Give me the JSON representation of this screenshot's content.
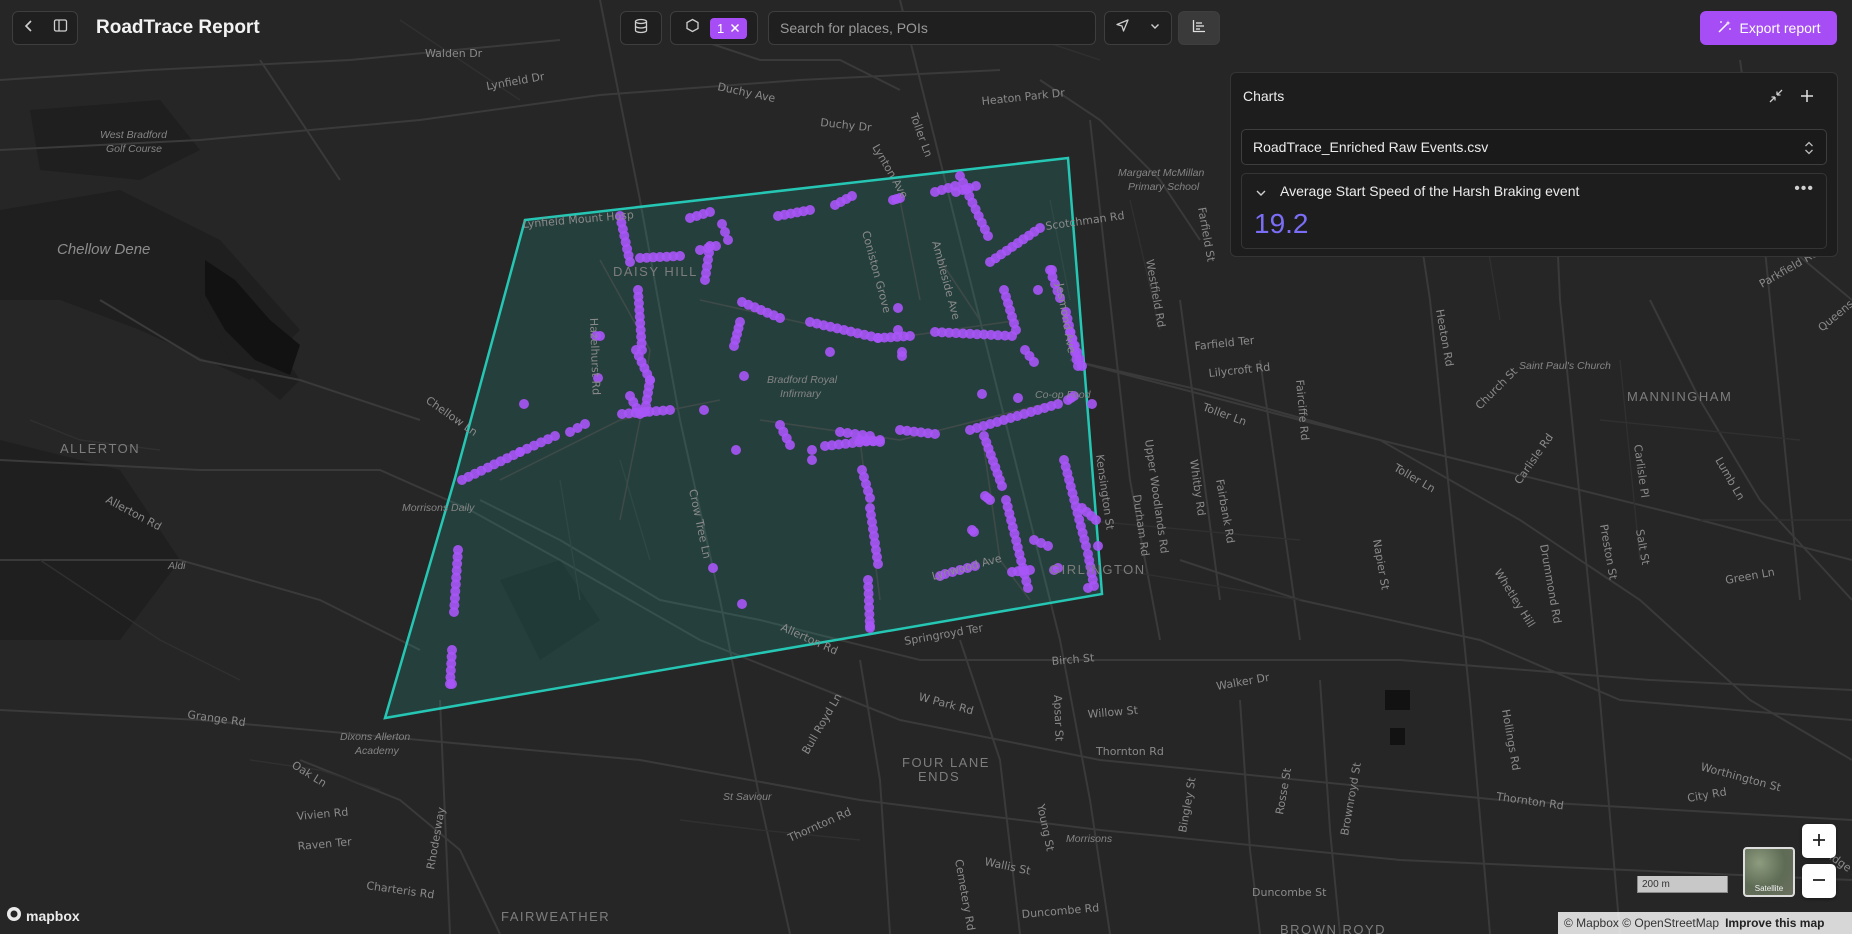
{
  "header": {
    "title": "RoadTrace Report",
    "filter_count": "1",
    "search_placeholder": "Search for places, POIs",
    "export_label": "Export report"
  },
  "charts_panel": {
    "title": "Charts",
    "dataset": "RoadTrace_Enriched Raw Events.csv",
    "metric": {
      "title": "Average Start Speed of the Harsh Braking event",
      "value": "19.2"
    }
  },
  "map": {
    "scale_label": "200 m",
    "satellite_label": "Satellite",
    "attribution": "© Mapbox © OpenStreetMap",
    "improve_label": "Improve this map",
    "logo_text": "mapbox",
    "colors": {
      "polygon": "#25c7b4",
      "events": "#a855f7",
      "accent": "#a64df5",
      "metric": "#7b6ef6"
    },
    "labels": {
      "walden": "Walden Dr",
      "lynfield": "Lynfield Dr",
      "duchy_ave": "Duchy Ave",
      "duchy_dr": "Duchy Dr",
      "toller_ln_n": "Toller Ln",
      "heaton_park": "Heaton Park Dr",
      "lynton": "Lynton Ave",
      "west_bradford": "West Bradford",
      "golf_course": "Golf Course",
      "chellow_dene": "Chellow Dene",
      "margaret1": "Margaret McMillan",
      "margaret2": "Primary School",
      "lynfield_hosp": "Lynfield Mount Hosp",
      "daisy_hill": "DAISY HILL",
      "scotchman": "Scotchman Rd",
      "coniston": "Coniston Grove",
      "ambleside": "Ambleside Ave",
      "jesmond": "Jesmond Ave",
      "hazelhurst": "Hazelhurst Rd",
      "infirmary1": "Bradford Royal",
      "infirmary2": "Infirmary",
      "farfield_st": "Farfield St",
      "westfield": "Westfield Rd",
      "farfield_ter": "Farfield Ter",
      "lilycroft": "Lilycroft Rd",
      "toller_ln_e": "Toller Ln",
      "coop": "Co-op Food",
      "allerton": "ALLERTON",
      "chellow_ln": "Chellow Ln",
      "allerton_rd": "Allerton Rd",
      "aldi": "Aldi",
      "morrisons_daily": "Morrisons Daily",
      "crow_tree": "Crow Tree Ln",
      "lynwood": "Lynwood Ave",
      "girlington": "GIRLINGTON",
      "kensington": "Kensington St",
      "upper_woodlands": "Upper Woodlands Rd",
      "durham": "Durham Rd",
      "whitby": "Whitby Rd",
      "fairbank": "Fairbank Rd",
      "allerton_rd2": "Allerton Rd",
      "springroyd": "Springroyd Ter",
      "birch": "Birch St",
      "walker": "Walker Dr",
      "w_park": "W Park Rd",
      "willow": "Willow St",
      "thornton_1": "Thornton Rd",
      "thornton_2": "Thornton Rd",
      "thornton_3": "Thornton Rd",
      "four_lane_1": "FOUR LANE",
      "four_lane_2": "ENDS",
      "st_saviour": "St Saviour",
      "grange": "Grange Rd",
      "dixons1": "Dixons Allerton",
      "dixons2": "Academy",
      "oak_ln": "Oak Ln",
      "vivien": "Vivien Rd",
      "raven": "Raven Ter",
      "charteris": "Charteris Rd",
      "rhodesway": "Rhodesway",
      "fairweather": "FAIRWEATHER",
      "bull_royd": "Bull Royd Ln",
      "cemetery": "Cemetery Rd",
      "young": "Young St",
      "morrisons": "Morrisons",
      "wallis": "Wallis St",
      "duncombe_st": "Duncombe St",
      "duncombe_rd": "Duncombe Rd",
      "brown_royd": "BROWN ROYD",
      "bingley": "Bingley St",
      "rosse": "Rosse St",
      "brownroyd": "Brownroyd St",
      "hollings": "Hollings Rd",
      "city_rd": "City Rd",
      "worthington": "Worthington St",
      "napier": "Napier St",
      "whetley": "Whetley Hill",
      "carlisle": "Carlisle Rd",
      "church_st": "Church St",
      "saint_paul": "Saint Paul's Church",
      "manningham": "MANNINGHAM",
      "heaton_rd": "Heaton Rd",
      "parkfield": "Parkfield Rd",
      "drummond": "Drummond Rd",
      "preston": "Preston St",
      "salt_st": "Salt St",
      "green_ln": "Green Ln",
      "toller_ln_e2": "Toller Ln",
      "lumb": "Lumb Ln",
      "apsar": "Apsar St",
      "fairciffe": "Fairciffe Rd",
      "carlisle_pl": "Carlisle Pl",
      "sunbridge": "Sunbridge Rd",
      "queens": "Queens Rd"
    }
  }
}
